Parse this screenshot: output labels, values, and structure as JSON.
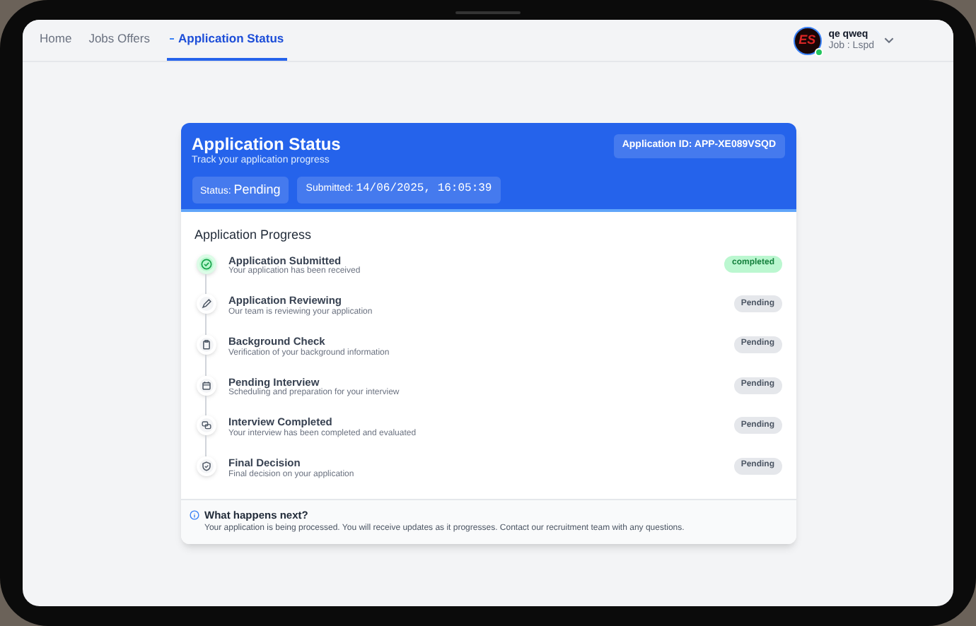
{
  "nav": {
    "items": [
      {
        "label": "Home",
        "selected": false
      },
      {
        "label": "Jobs Offers",
        "selected": false
      },
      {
        "label": "Application Status",
        "selected": true
      }
    ]
  },
  "user": {
    "avatar_text": "ES",
    "online": true,
    "name": "qe qweq",
    "job": "Job : Lspd"
  },
  "header": {
    "title": "Application Status",
    "subtitle": "Track your application progress",
    "application_id": "Application ID: APP-XE089VSQD",
    "status_label": "Status:",
    "status_value": "Pending",
    "submitted_label": "Submitted:",
    "submitted_value": "14/06/2025, 16:05:39"
  },
  "progress": {
    "title": "Application Progress",
    "steps": [
      {
        "title": "Application Submitted",
        "description": "Your application has been received",
        "status": "completed",
        "kind": "completed"
      },
      {
        "title": "Application Reviewing",
        "description": "Our team is reviewing your application",
        "status": "Pending",
        "kind": "pending"
      },
      {
        "title": "Background Check",
        "description": "Verification of your background information",
        "status": "Pending",
        "kind": "pending"
      },
      {
        "title": "Pending Interview",
        "description": "Scheduling and preparation for your interview",
        "status": "Pending",
        "kind": "pending"
      },
      {
        "title": "Interview Completed",
        "description": "Your interview has been completed and evaluated",
        "status": "Pending",
        "kind": "pending"
      },
      {
        "title": "Final Decision",
        "description": "Final decision on your application",
        "status": "Pending",
        "kind": "pending"
      }
    ]
  },
  "next": {
    "title": "What happens next?",
    "text": "Your application is being processed. You will receive updates as it progresses. Contact our recruitment team with any questions."
  }
}
